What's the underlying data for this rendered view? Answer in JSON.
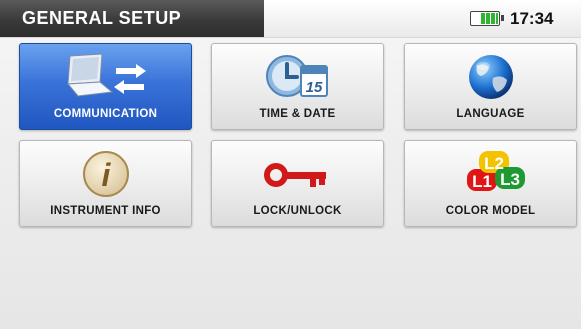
{
  "header": {
    "title": "GENERAL SETUP",
    "time": "17:34",
    "battery_level": 0.65
  },
  "tiles": [
    {
      "label": "COMMUNICATION",
      "icon": "laptop-transfer-icon",
      "selected": true
    },
    {
      "label": "TIME & DATE",
      "icon": "clock-calendar-icon",
      "calendar_day": "15"
    },
    {
      "label": "LANGUAGE",
      "icon": "globe-icon"
    },
    {
      "label": "INSTRUMENT INFO",
      "icon": "info-icon",
      "icon_glyph": "i"
    },
    {
      "label": "LOCK/UNLOCK",
      "icon": "key-icon"
    },
    {
      "label": "COLOR MODEL",
      "icon": "color-model-icon",
      "phases": [
        "L1",
        "L2",
        "L3"
      ]
    }
  ],
  "colors": {
    "selected_tile": "#3a73d8",
    "title_bar": "#3a3a3a",
    "battery": "#2fb52f",
    "key": "#d11919",
    "phase_l1": "#e01515",
    "phase_l2": "#f3c300",
    "phase_l3": "#1f9a32"
  }
}
